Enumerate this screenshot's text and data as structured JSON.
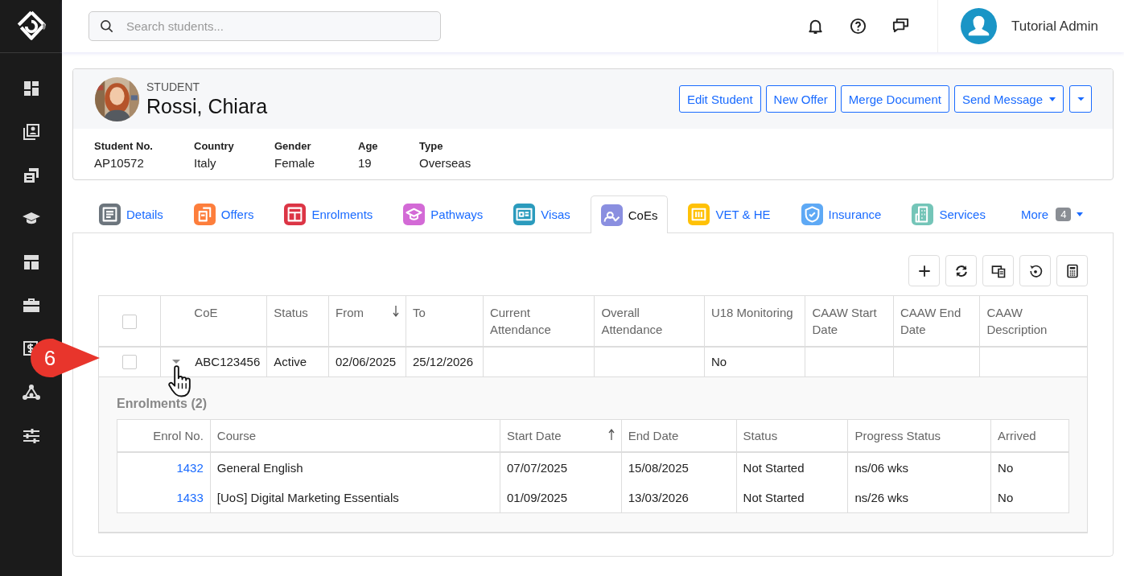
{
  "search": {
    "placeholder": "Search students..."
  },
  "user": {
    "name": "Tutorial Admin"
  },
  "student": {
    "label": "STUDENT",
    "name": "Rossi, Chiara"
  },
  "actions": [
    {
      "label": "Edit Student",
      "dropdown": false
    },
    {
      "label": "New Offer",
      "dropdown": false
    },
    {
      "label": "Merge Document",
      "dropdown": false
    },
    {
      "label": "Send Message",
      "dropdown": true
    }
  ],
  "fields": [
    {
      "label": "Student No.",
      "value": "AP10572"
    },
    {
      "label": "Country",
      "value": "Italy"
    },
    {
      "label": "Gender",
      "value": "Female"
    },
    {
      "label": "Age",
      "value": "19"
    },
    {
      "label": "Type",
      "value": "Overseas"
    }
  ],
  "tabs": [
    {
      "label": "Details",
      "color": "#6c757d",
      "selected": false
    },
    {
      "label": "Offers",
      "color": "#fd7e3c",
      "selected": false
    },
    {
      "label": "Enrolments",
      "color": "#dc3545",
      "selected": false
    },
    {
      "label": "Pathways",
      "color": "#d36ad6",
      "selected": false
    },
    {
      "label": "Visas",
      "color": "#2b9bbd",
      "selected": false
    },
    {
      "label": "CoEs",
      "color": "#8a8fe0",
      "selected": true
    },
    {
      "label": "VET & HE",
      "color": "#ffc107",
      "selected": false
    },
    {
      "label": "Insurance",
      "color": "#5ea9f5",
      "selected": false
    },
    {
      "label": "Services",
      "color": "#74c5b8",
      "selected": false
    }
  ],
  "more_tab": {
    "label": "More",
    "count": "4"
  },
  "table": {
    "all_checked": false,
    "columns": [
      {
        "label": "CoE",
        "sorted": false
      },
      {
        "label": "Status",
        "sorted": false
      },
      {
        "label": "From",
        "sorted": true,
        "ascending": false
      },
      {
        "label": "To",
        "sorted": false
      },
      {
        "label": "Current Attendance",
        "sorted": false
      },
      {
        "label": "Overall Attendance",
        "sorted": false
      },
      {
        "label": "U18 Monitoring",
        "sorted": false
      },
      {
        "label": "CAAW Start Date",
        "sorted": false
      },
      {
        "label": "CAAW End Date",
        "sorted": false
      },
      {
        "label": "CAAW Description",
        "sorted": false
      }
    ],
    "rows": [
      {
        "checked": false,
        "expanded": true,
        "cells": [
          "ABC123456",
          "Active",
          "02/06/2025",
          "25/12/2026",
          "",
          "",
          "No",
          "",
          "",
          ""
        ]
      }
    ]
  },
  "enrolments": {
    "title": "Enrolments (2)",
    "columns": [
      {
        "label": "Enrol No.",
        "sorted": false
      },
      {
        "label": "Course",
        "sorted": false
      },
      {
        "label": "Start Date",
        "sorted": true,
        "ascending": true
      },
      {
        "label": "End Date",
        "sorted": false
      },
      {
        "label": "Status",
        "sorted": false
      },
      {
        "label": "Progress Status",
        "sorted": false
      },
      {
        "label": "Arrived",
        "sorted": false
      }
    ],
    "rows": [
      [
        "1432",
        "General English",
        "07/07/2025",
        "15/08/2025",
        "Not Started",
        "ns/06 wks",
        "No"
      ],
      [
        "1433",
        "[UoS] Digital Marketing Essentials",
        "01/09/2025",
        "13/03/2026",
        "Not Started",
        "ns/26 wks",
        "No"
      ]
    ]
  },
  "callout": {
    "number": "6"
  }
}
